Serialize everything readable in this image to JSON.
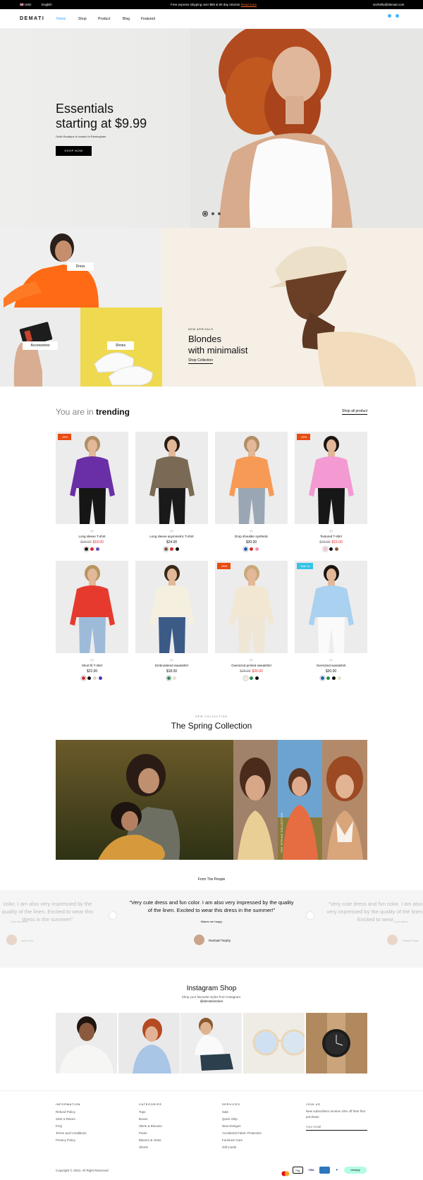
{
  "topbar": {
    "currency": "USD",
    "language": "English",
    "promo": "Free express shipping over $50 & 60 day returns!",
    "promo_link": "Read more",
    "email": "sezhello@demati.com"
  },
  "nav": {
    "logo": "DEMATI",
    "links": [
      "Home",
      "Shop",
      "Product",
      "Blog",
      "Featured"
    ]
  },
  "hero": {
    "title_line1": "Essentials",
    "title_line2": "starting at $9.99",
    "subtitle": "Outfe Boutique is located in Birmingham",
    "button": "SHOP NOW"
  },
  "categories": {
    "dress": "Dress",
    "accessories": "Accessories",
    "shoes": "Shoes",
    "kicker": "NEW ARRIVALS",
    "heading_line1": "Blondes",
    "heading_line2": "with minimalist",
    "link": "Shop Collection"
  },
  "trending": {
    "title_prefix": "You are in",
    "title_bold": "trending",
    "shop_all": "Shop all product",
    "products": [
      {
        "badge": "-25%",
        "rating": "(0)",
        "name": "Long sleeve T-shirt",
        "old": "$20.00",
        "price": "$18.00",
        "sale": true,
        "swatches": [
          "#111111",
          "#d32f2f",
          "#6b4fbb"
        ]
      },
      {
        "badge": "",
        "rating": "(0)",
        "name": "Long sleeve asymmetric T-shirt",
        "old": "",
        "price": "$24.00",
        "sale": false,
        "swatches": [
          "#7a5a40",
          "#d32f2f",
          "#111111"
        ]
      },
      {
        "badge": "",
        "rating": "(0)",
        "name": "Drop shoulder synthetic",
        "old": "",
        "price": "$30.00",
        "sale": false,
        "swatches": [
          "#1f5fb0",
          "#d32f2f",
          "#f48fb1"
        ]
      },
      {
        "badge": "-25%",
        "rating": "(0)",
        "name": "Textured T-shirt",
        "old": "$20.00",
        "price": "$15.00",
        "sale": true,
        "swatches": [
          "#f8bbd0",
          "#111111",
          "#8d5a3b"
        ]
      },
      {
        "badge": "",
        "rating": "(0)",
        "name": "Short fit T-shirt",
        "old": "",
        "price": "$22.00",
        "sale": false,
        "swatches": [
          "#d32f2f",
          "#111111",
          "#e0d6c8",
          "#3f3fb5"
        ]
      },
      {
        "badge": "",
        "rating": "(0)",
        "name": "Embroidered sweatshirt",
        "old": "",
        "price": "$18.00",
        "sale": false,
        "swatches": [
          "#2e8b57",
          "#e8e0d0"
        ]
      },
      {
        "badge": "-25%",
        "rating": "(0)",
        "name": "Oversized printed sweatshirt",
        "old": "$25.00",
        "price": "$20.00",
        "sale": true,
        "swatches": [
          "#efe6d6",
          "#2e8b57",
          "#111111"
        ]
      },
      {
        "badge": "Sale 1s",
        "rating": "(1)",
        "name": "Oversized sweatshirt",
        "old": "",
        "price": "$20.00",
        "sale": false,
        "swatches": [
          "#1f5fb0",
          "#2e8b57",
          "#111111",
          "#e8e0d0"
        ]
      }
    ]
  },
  "spring": {
    "kicker": "NEW COLLECTION",
    "title": "The Spring Collection",
    "vertical_label": "THE SPRING COLLECTION"
  },
  "testimonials": {
    "title": "From The People",
    "quote": "“Very cute dress and fun color. I am also very impressed by the quality of the linen. Excited to wear this dress in the summer!”",
    "left_quote": "color. I am also very impressed by the quality of the linen. Excited to wear this dress in the summer!”",
    "right_quote": "“Very cute dress and fun color. I am also very impressed by the quality of the linen. Excited to wear",
    "caption": "Makes me happy",
    "author": "Rachael Torphy",
    "left_caption": "I love the shirt",
    "left_author": "John Doe",
    "right_caption": "I love dress",
    "right_author": "Estelle Ryan"
  },
  "instagram": {
    "title": "Instagram Shop",
    "subtitle": "Shop your favourite styles from Instagram.",
    "handle": "@dematizestore"
  },
  "footer": {
    "columns": [
      {
        "heading": "INFORMATION",
        "items": [
          "Refund Policy",
          "Start a Return",
          "FAQ",
          "Terms and Conditions",
          "Privacy Policy"
        ]
      },
      {
        "heading": "CATEGORIES",
        "items": [
          "Tops",
          "Boxes",
          "Skirts & Blouses",
          "Pants",
          "Blazers & Vests",
          "Shorts"
        ]
      },
      {
        "heading": "SERVICES",
        "items": [
          "Sale",
          "Quick Ship",
          "New Designs",
          "Accidental Fabric Protection",
          "Furniture Care",
          "Gift Cards"
        ]
      }
    ],
    "join_heading": "JOIN US",
    "join_text": "New subscribers receive 10% off their first purchase",
    "email_placeholder": "Your email",
    "copyright": "Copyright © 2024. All Right Reserved",
    "payments": [
      "VISA",
      "Pay",
      "P",
      "clearpay"
    ]
  }
}
